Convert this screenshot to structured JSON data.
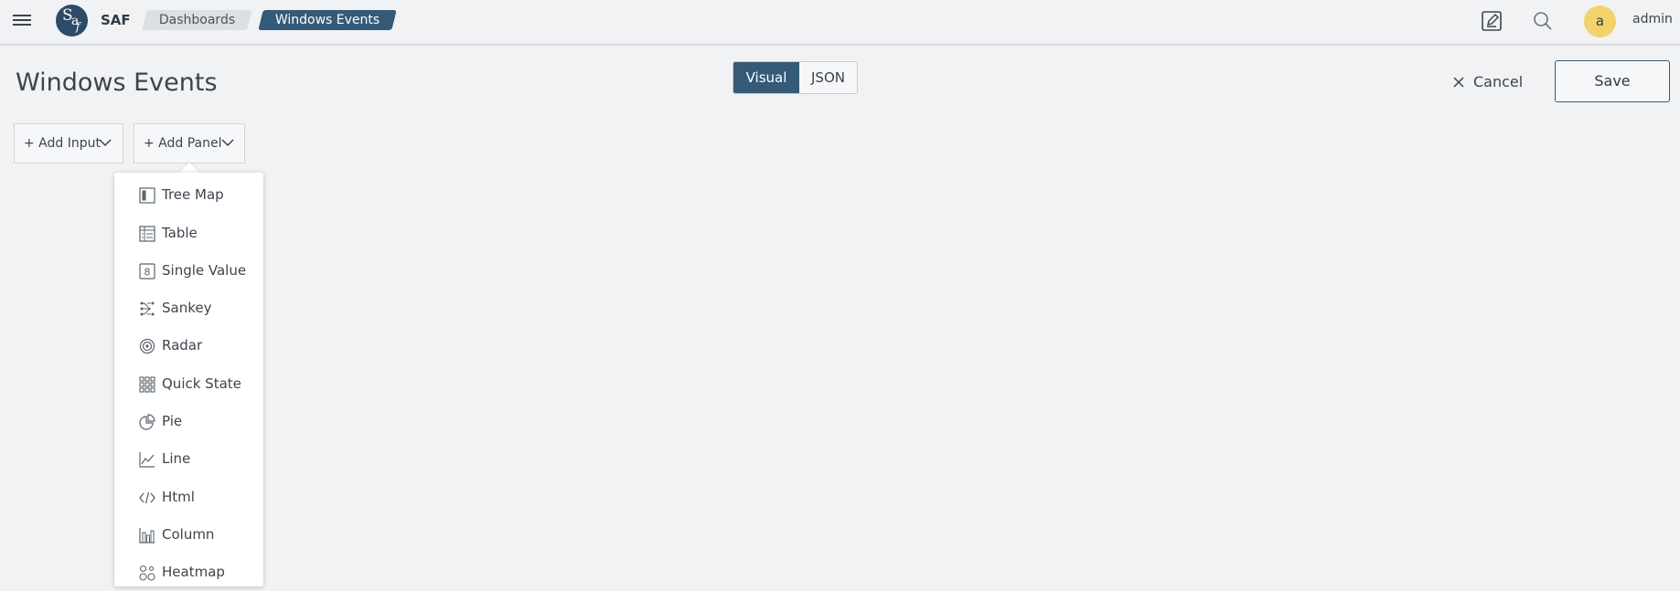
{
  "app": {
    "name": "SAF",
    "logo_letters": [
      "S",
      "a",
      "f"
    ]
  },
  "breadcrumb": [
    "Dashboards",
    "Windows Events"
  ],
  "user": {
    "initial": "a",
    "name": "admin"
  },
  "page": {
    "title": "Windows Events"
  },
  "mode_toggle": {
    "options": [
      "Visual",
      "JSON"
    ],
    "selected": "Visual"
  },
  "actions": {
    "cancel": "Cancel",
    "save": "Save"
  },
  "toolbar": {
    "add_input": "+ Add Input",
    "add_panel": "+ Add Panel"
  },
  "panel_menu": {
    "items": [
      {
        "label": "Tree Map",
        "icon": "tree-map-icon"
      },
      {
        "label": "Table",
        "icon": "table-icon"
      },
      {
        "label": "Single Value",
        "icon": "single-value-icon"
      },
      {
        "label": "Sankey",
        "icon": "sankey-icon"
      },
      {
        "label": "Radar",
        "icon": "radar-icon"
      },
      {
        "label": "Quick State",
        "icon": "quick-state-icon"
      },
      {
        "label": "Pie",
        "icon": "pie-icon"
      },
      {
        "label": "Line",
        "icon": "line-icon"
      },
      {
        "label": "Html",
        "icon": "html-icon"
      },
      {
        "label": "Column",
        "icon": "column-icon"
      },
      {
        "label": "Heatmap",
        "icon": "heatmap-icon"
      }
    ]
  },
  "colors": {
    "accent": "#355a77",
    "avatar": "#f2d36b",
    "background": "#f1f2f4"
  }
}
